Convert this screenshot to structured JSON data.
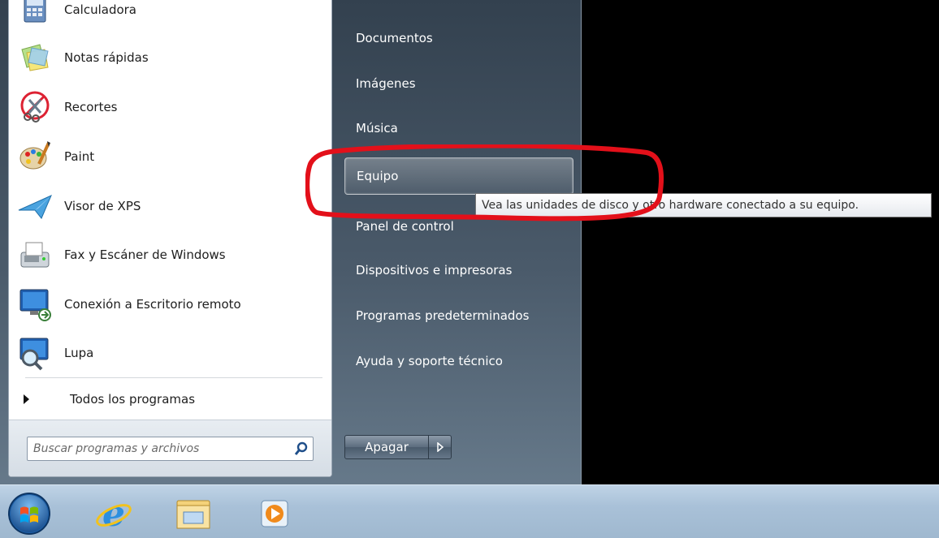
{
  "programs": [
    {
      "label": "Calculadora",
      "icon": "calculator-icon"
    },
    {
      "label": "Notas rápidas",
      "icon": "sticky-notes-icon"
    },
    {
      "label": "Recortes",
      "icon": "snipping-tool-icon"
    },
    {
      "label": "Paint",
      "icon": "paint-icon"
    },
    {
      "label": "Visor de XPS",
      "icon": "xps-viewer-icon"
    },
    {
      "label": "Fax y Escáner de Windows",
      "icon": "fax-scanner-icon"
    },
    {
      "label": "Conexión a Escritorio remoto",
      "icon": "remote-desktop-icon"
    },
    {
      "label": "Lupa",
      "icon": "magnifier-icon"
    }
  ],
  "all_programs_label": "Todos los programas",
  "search": {
    "placeholder": "Buscar programas y archivos"
  },
  "right_items": [
    {
      "label": "Documentos"
    },
    {
      "label": "Imágenes"
    },
    {
      "label": "Música"
    },
    {
      "label": "Equipo"
    },
    {
      "label": "Panel de control"
    },
    {
      "label": "Dispositivos e impresoras"
    },
    {
      "label": "Programas predeterminados"
    },
    {
      "label": "Ayuda y soporte técnico"
    }
  ],
  "shutdown_label": "Apagar",
  "tooltip_text": "Vea las unidades de disco y otro hardware conectado a su equipo.",
  "annotation_color": "#e3101a",
  "taskbar_items": [
    {
      "icon": "start-orb-icon"
    },
    {
      "icon": "internet-explorer-icon"
    },
    {
      "icon": "file-explorer-icon"
    },
    {
      "icon": "media-player-icon"
    }
  ]
}
